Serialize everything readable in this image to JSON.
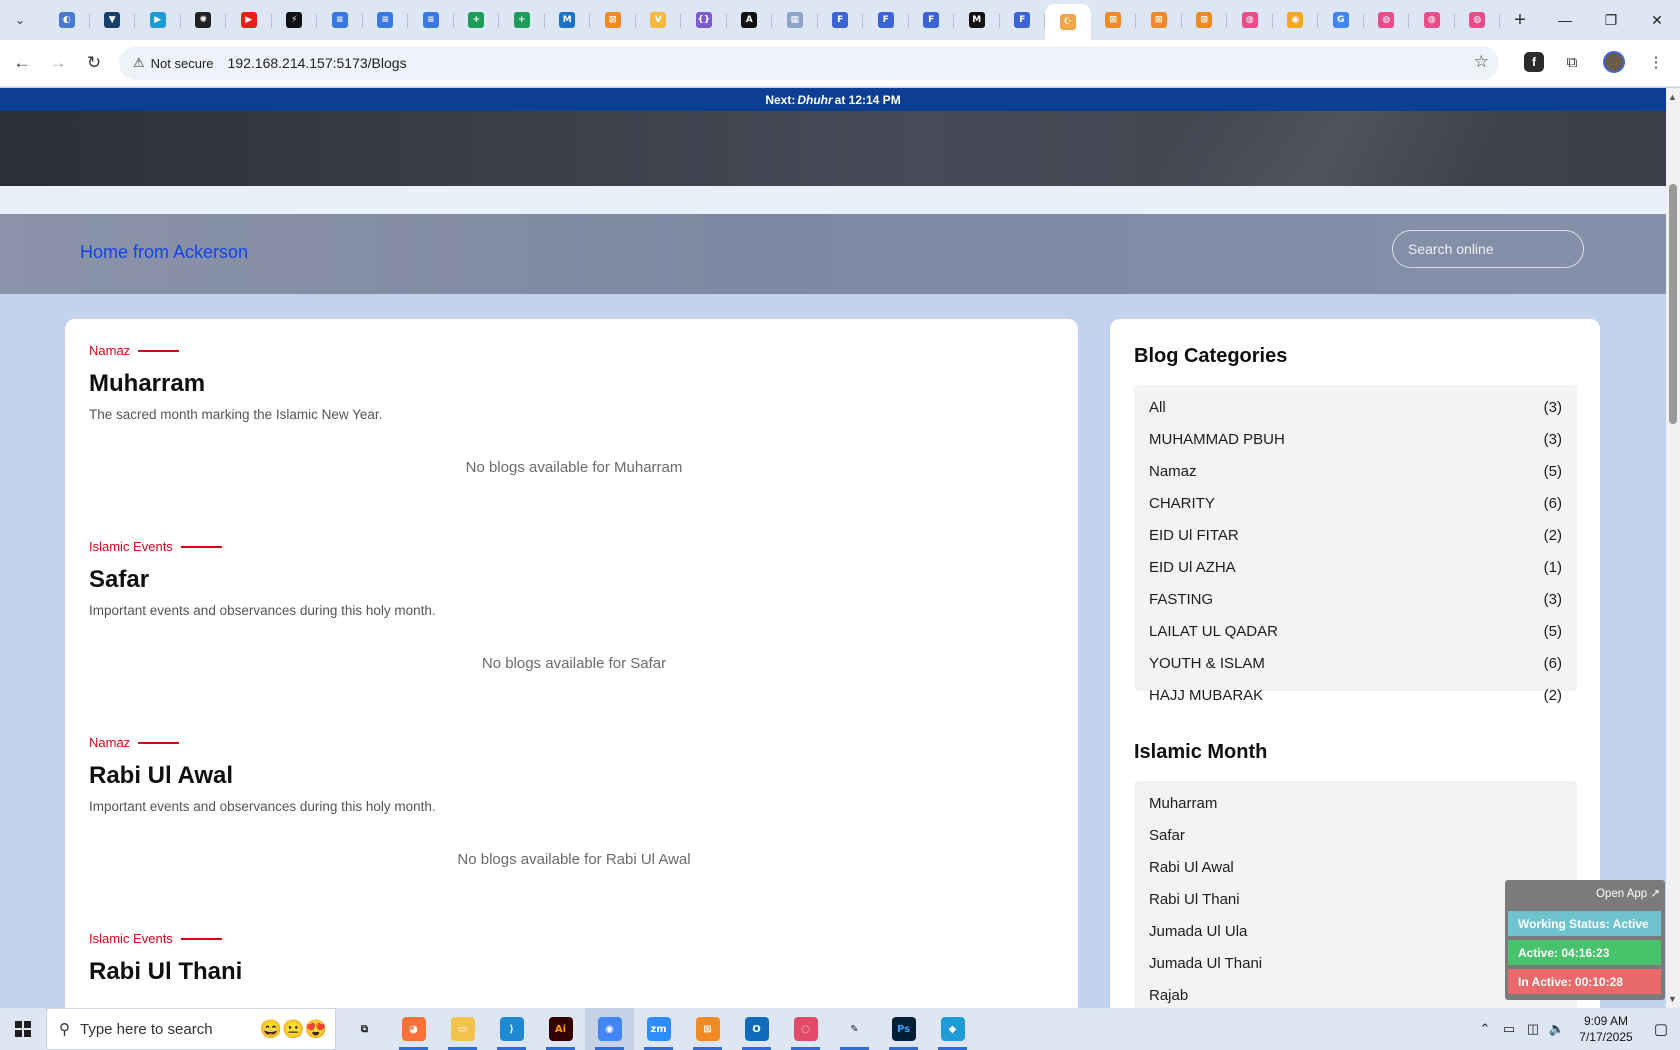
{
  "browser": {
    "tabs": [
      {
        "icon": "globe-tab-icon",
        "color": "#4a7bd0",
        "glyph": "◐"
      },
      {
        "icon": "shield-tab-icon",
        "color": "#17406b",
        "glyph": "▼"
      },
      {
        "icon": "play-tab-icon",
        "color": "#1e9bd7",
        "glyph": "▶"
      },
      {
        "icon": "chatgpt-tab-icon",
        "color": "#222222",
        "glyph": "✺"
      },
      {
        "icon": "youtube-tab-icon",
        "color": "#e62117",
        "glyph": "▶"
      },
      {
        "icon": "bolt-tab-icon",
        "color": "#111111",
        "glyph": "⚡"
      },
      {
        "icon": "docs-tab-icon",
        "color": "#3b78e7",
        "glyph": "≡"
      },
      {
        "icon": "docs-tab-icon",
        "color": "#3b78e7",
        "glyph": "≡"
      },
      {
        "icon": "docs-tab-icon",
        "color": "#3b78e7",
        "glyph": "≡"
      },
      {
        "icon": "sheets-tab-icon",
        "color": "#1e9d58",
        "glyph": "+"
      },
      {
        "icon": "sheets-tab-icon",
        "color": "#1e9d58",
        "glyph": "+"
      },
      {
        "icon": "outlook-tab-icon",
        "color": "#1a73c8",
        "glyph": "M"
      },
      {
        "icon": "xampp-tab-icon",
        "color": "#f08a24",
        "glyph": "⊠"
      },
      {
        "icon": "vue-tab-icon",
        "color": "#f5b942",
        "glyph": "V"
      },
      {
        "icon": "braces-tab-icon",
        "color": "#7a5cd6",
        "glyph": "{}"
      },
      {
        "icon": "angular-tab-icon",
        "color": "#111111",
        "glyph": "A"
      },
      {
        "icon": "grid-tab-icon",
        "color": "#8fa3c9",
        "glyph": "▦"
      },
      {
        "icon": "forms-tab-icon",
        "color": "#3b63d6",
        "glyph": "F"
      },
      {
        "icon": "forms-tab-icon",
        "color": "#3b63d6",
        "glyph": "F"
      },
      {
        "icon": "forms-tab-icon",
        "color": "#3b63d6",
        "glyph": "F"
      },
      {
        "icon": "medium-tab-icon",
        "color": "#111111",
        "glyph": "M"
      },
      {
        "icon": "forms-tab-icon",
        "color": "#3b63d6",
        "glyph": "F"
      },
      {
        "icon": "local-app-tab-icon",
        "color": "#f0a64a",
        "glyph": "☪",
        "active": true
      },
      {
        "icon": "xampp-tab-icon",
        "color": "#f08a24",
        "glyph": "⊠"
      },
      {
        "icon": "xampp-tab-icon",
        "color": "#f08a24",
        "glyph": "⊠"
      },
      {
        "icon": "xampp-tab-icon",
        "color": "#f08a24",
        "glyph": "⊠"
      },
      {
        "icon": "dribbble-tab-icon",
        "color": "#ea4c89",
        "glyph": "◍"
      },
      {
        "icon": "color-tab-icon",
        "color": "#f5a623",
        "glyph": "◉"
      },
      {
        "icon": "google-tab-icon",
        "color": "#4285f4",
        "glyph": "G"
      },
      {
        "icon": "dribbble-tab-icon",
        "color": "#ea4c89",
        "glyph": "◍"
      },
      {
        "icon": "dribbble-tab-icon",
        "color": "#ea4c89",
        "glyph": "◍"
      },
      {
        "icon": "dribbble-tab-icon",
        "color": "#ea4c89",
        "glyph": "◍"
      }
    ],
    "security_label": "Not secure",
    "url": "192.168.214.157:5173/Blogs"
  },
  "page": {
    "prayer_prefix": "Next: ",
    "prayer_name": "Dhuhr",
    "prayer_suffix": " at 12:14 PM",
    "header_link": "Home from Ackerson",
    "search_placeholder": "Search online",
    "accent_color": "#d4071a",
    "months": [
      {
        "category": "Namaz",
        "title": "Muharram",
        "description": "The sacred month marking the Islamic New Year.",
        "empty": "No blogs available for Muharram"
      },
      {
        "category": "Islamic Events",
        "title": "Safar",
        "description": "Important events and observances during this holy month.",
        "empty": "No blogs available for Safar"
      },
      {
        "category": "Namaz",
        "title": "Rabi Ul Awal",
        "description": "Important events and observances during this holy month.",
        "empty": "No blogs available for Rabi Ul Awal"
      },
      {
        "category": "Islamic Events",
        "title": "Rabi Ul Thani",
        "description": "",
        "empty": ""
      }
    ]
  },
  "sidebar": {
    "categories_title": "Blog Categories",
    "categories": [
      {
        "name": "All",
        "count": "(3)"
      },
      {
        "name": "MUHAMMAD PBUH",
        "count": "(3)"
      },
      {
        "name": "Namaz",
        "count": "(5)"
      },
      {
        "name": "CHARITY",
        "count": "(6)"
      },
      {
        "name": "EID Ul FITAR",
        "count": "(2)"
      },
      {
        "name": "EID Ul AZHA",
        "count": "(1)"
      },
      {
        "name": "FASTING",
        "count": "(3)"
      },
      {
        "name": "LAILAT UL QADAR",
        "count": "(5)"
      },
      {
        "name": "YOUTH & ISLAM",
        "count": "(6)"
      },
      {
        "name": "HAJJ MUBARAK",
        "count": "(2)"
      }
    ],
    "months_title": "Islamic Month",
    "months": [
      "Muharram",
      "Safar",
      "Rabi Ul Awal",
      "Rabi Ul Thani",
      "Jumada Ul Ula",
      "Jumada Ul Thani",
      "Rajab"
    ]
  },
  "widget": {
    "open_label": "Open App ↗",
    "status": "Working Status: Active",
    "active": "Active: 04:16:23",
    "inactive": "In Active: 00:10:28"
  },
  "taskbar": {
    "search_placeholder": "Type here to search",
    "apps": [
      {
        "icon": "task-view-icon",
        "color": "#dfe6f3",
        "glyph": "⧉",
        "text_color": "#222"
      },
      {
        "icon": "firefox-icon",
        "color": "#ff7139",
        "glyph": "◕",
        "text_color": "#fff"
      },
      {
        "icon": "file-explorer-icon",
        "color": "#f2c14e",
        "glyph": "▭",
        "text_color": "#fff"
      },
      {
        "icon": "vscode-icon",
        "color": "#1f8ad2",
        "glyph": "⟩",
        "text_color": "#fff"
      },
      {
        "icon": "illustrator-icon",
        "color": "#330000",
        "glyph": "Ai",
        "text_color": "#ff9a00"
      },
      {
        "icon": "chrome-icon",
        "color": "#4285f4",
        "glyph": "◉",
        "text_color": "#fff",
        "active": true
      },
      {
        "icon": "zoom-icon",
        "color": "#2d8cff",
        "glyph": "zm",
        "text_color": "#fff"
      },
      {
        "icon": "xampp-icon",
        "color": "#f08a24",
        "glyph": "⊠",
        "text_color": "#fff"
      },
      {
        "icon": "outlook-icon",
        "color": "#0f6cbd",
        "glyph": "O",
        "text_color": "#fff"
      },
      {
        "icon": "creative-cloud-icon",
        "color": "#e24a6a",
        "glyph": "◌",
        "text_color": "#fff"
      },
      {
        "icon": "pen-tool-icon",
        "color": "#dfe6f3",
        "glyph": "✎",
        "text_color": "#222"
      },
      {
        "icon": "photoshop-icon",
        "color": "#001e36",
        "glyph": "Ps",
        "text_color": "#31a8ff"
      },
      {
        "icon": "app-icon",
        "color": "#1f9bd6",
        "glyph": "◆",
        "text_color": "#fff"
      }
    ],
    "time": "9:09 AM",
    "date": "7/17/2025"
  }
}
